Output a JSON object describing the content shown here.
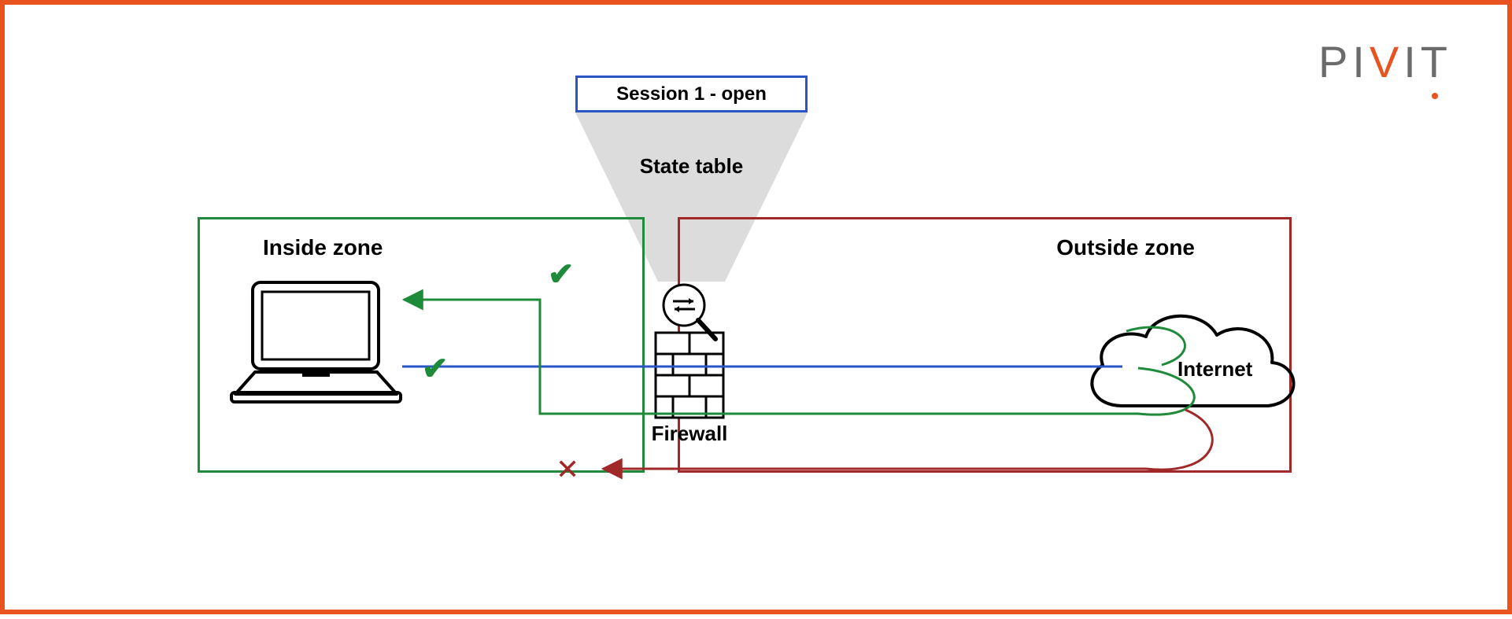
{
  "logo": {
    "part1": "PI",
    "part2": "V",
    "part3": "IT"
  },
  "session_box": "Session 1 - open",
  "state_table_label": "State table",
  "firewall_label": "Firewall",
  "zones": {
    "inside": "Inside zone",
    "outside": "Outside zone"
  },
  "cloud_label": "Internet",
  "marks": {
    "check_upper": "✔",
    "check_lower": "✔",
    "x_blocked": "✕"
  },
  "colors": {
    "frame": "#e8531f",
    "inside_border": "#1e8a3a",
    "outside_border": "#a12828",
    "session_border": "#2a55c9",
    "allowed_flow": "#1e8a3a",
    "request_flow": "#2a55c9",
    "blocked_flow": "#a12828",
    "cone_fill": "#dcdcdc"
  },
  "flows": {
    "outbound_request": {
      "from": "laptop",
      "to": "internet",
      "status": "allowed"
    },
    "return_traffic": {
      "from": "internet",
      "to": "laptop",
      "status": "allowed"
    },
    "unsolicited_inbound": {
      "from": "internet",
      "to": "laptop",
      "status": "blocked"
    }
  }
}
